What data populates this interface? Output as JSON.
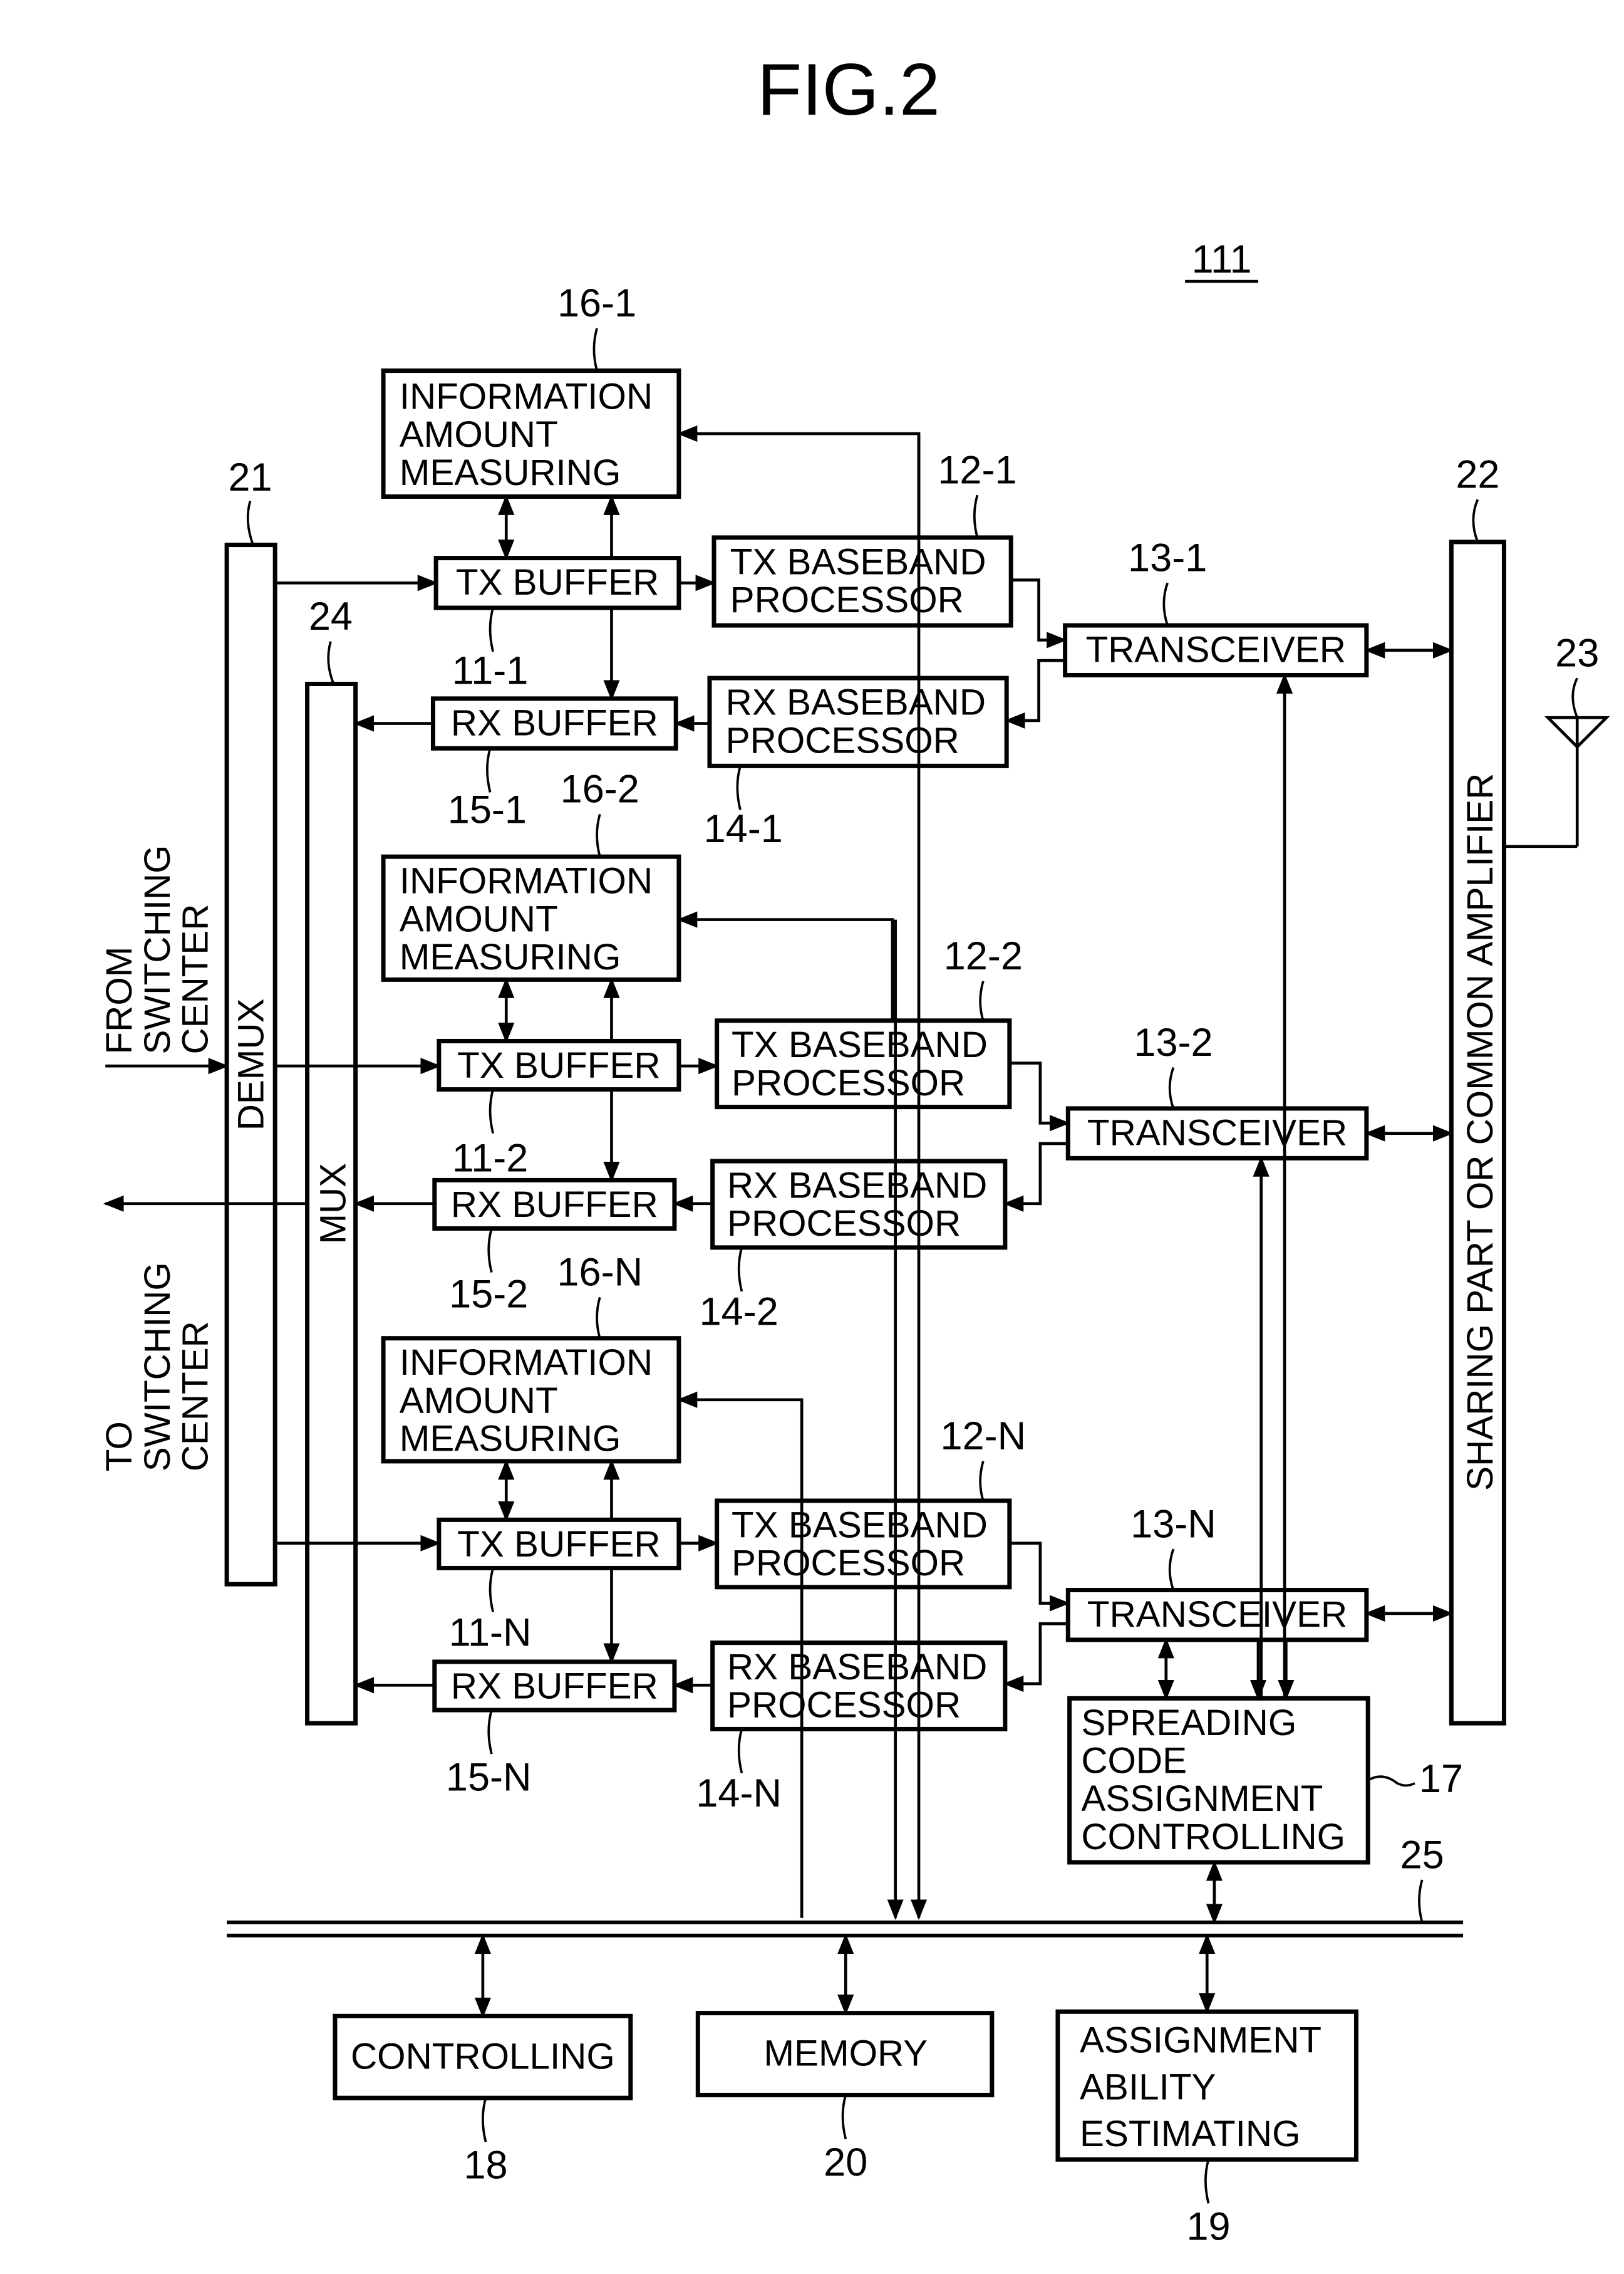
{
  "figure": {
    "title": "FIG.2",
    "device_ref": "111"
  },
  "blocks": {
    "info_measuring": {
      "lines": [
        "INFORMATION",
        "AMOUNT",
        "MEASURING"
      ]
    },
    "tx_buffer": "TX BUFFER",
    "rx_buffer": "RX BUFFER",
    "tx_baseband": [
      "TX BASEBAND",
      "PROCESSOR"
    ],
    "rx_baseband": [
      "RX BASEBAND",
      "PROCESSOR"
    ],
    "transceiver": "TRANSCEIVER",
    "demux": "DEMUX",
    "mux": "MUX",
    "sharing": "SHARING PART OR COMMON AMPLIFIER",
    "spreading": [
      "SPREADING",
      "CODE",
      "ASSIGNMENT",
      "CONTROLLING"
    ],
    "controlling": "CONTROLLING",
    "memory": "MEMORY",
    "assign_est": [
      "ASSIGNMENT",
      "ABILITY",
      "ESTIMATING"
    ]
  },
  "io_labels": {
    "from": [
      "FROM",
      "SWITCHING",
      "CENTER"
    ],
    "to": [
      "TO",
      "SWITCHING",
      "CENTER"
    ]
  },
  "refs": {
    "r16_1": "16-1",
    "r12_1": "12-1",
    "r13_1": "13-1",
    "r11_1": "11-1",
    "r15_1": "15-1",
    "r14_1": "14-1",
    "r16_2": "16-2",
    "r12_2": "12-2",
    "r13_2": "13-2",
    "r11_2": "11-2",
    "r15_2": "15-2",
    "r14_2": "14-2",
    "r16_n": "16-N",
    "r12_n": "12-N",
    "r13_n": "13-N",
    "r11_n": "11-N",
    "r15_n": "15-N",
    "r14_n": "14-N",
    "r21": "21",
    "r22": "22",
    "r23": "23",
    "r24": "24",
    "r25": "25",
    "r17": "17",
    "r18": "18",
    "r19": "19",
    "r20": "20"
  }
}
